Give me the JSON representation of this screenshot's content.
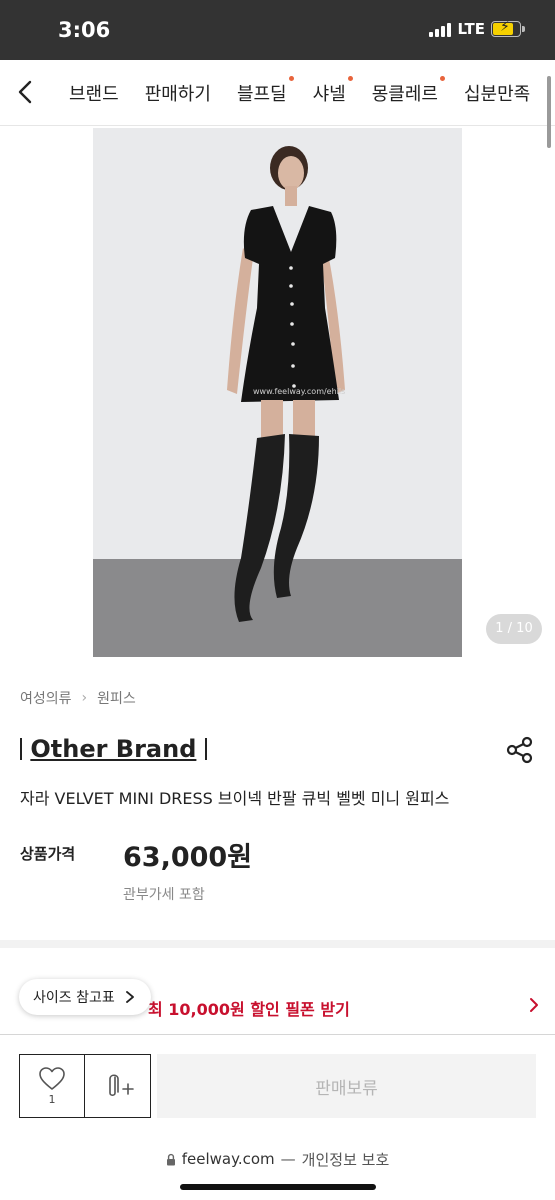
{
  "status_bar": {
    "time": "3:06",
    "network": "LTE",
    "icons": [
      "signal-icon",
      "battery-charging-icon"
    ]
  },
  "nav": {
    "back_icon": "chevron-left-icon",
    "items": [
      {
        "label": "브랜드",
        "dot": false
      },
      {
        "label": "판매하기",
        "dot": false
      },
      {
        "label": "블프딜",
        "dot": true
      },
      {
        "label": "샤넬",
        "dot": true
      },
      {
        "label": "몽클레르",
        "dot": true
      },
      {
        "label": "십분만족",
        "dot": false
      }
    ],
    "dot_color": "#e8643c"
  },
  "image": {
    "watermark": "www.feelway.com/ehils",
    "counter": "1 / 10"
  },
  "breadcrumb": [
    "여성의류",
    "원피스"
  ],
  "product": {
    "brand": "Other Brand",
    "name": "자라 VELVET MINI DRESS 브이넥 반팔 큐빅 벨벳 미니 원피스",
    "price_label": "상품가격",
    "price": "63,000원",
    "tax_note": "관부가세 포함"
  },
  "coupon": {
    "size_chart_label": "사이즈 참고표",
    "text": "최대 10,000원 할인 필폰 받기",
    "visible_text": "최 10,000원 할인 필폰 받기",
    "color": "#c8102e"
  },
  "actions": {
    "like_count": "1",
    "hold_label": "판매보류"
  },
  "browser": {
    "domain": "feelway.com",
    "separator": "—",
    "privacy": "개인정보 보호"
  }
}
